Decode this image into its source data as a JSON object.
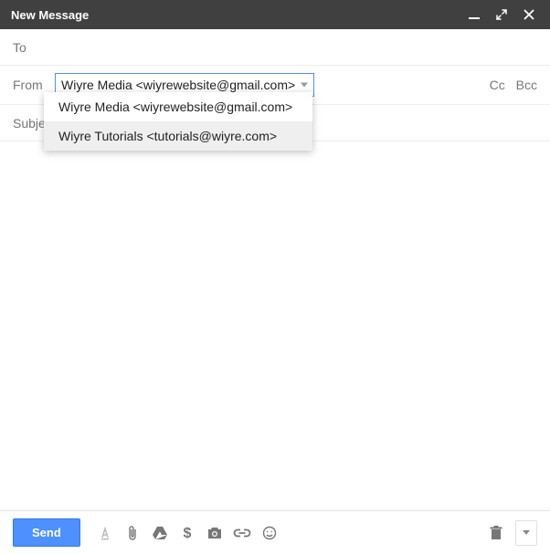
{
  "titlebar": {
    "title": "New Message"
  },
  "fields": {
    "to_label": "To",
    "from_label": "From",
    "subject_label": "Subject",
    "cc_label": "Cc",
    "bcc_label": "Bcc"
  },
  "from": {
    "selected": "Wiyre Media <wiyrewebsite@gmail.com>",
    "options": [
      "Wiyre Media <wiyrewebsite@gmail.com>",
      "Wiyre Tutorials <tutorials@wiyre.com>"
    ],
    "highlighted_index": 1
  },
  "footer": {
    "send_label": "Send"
  }
}
